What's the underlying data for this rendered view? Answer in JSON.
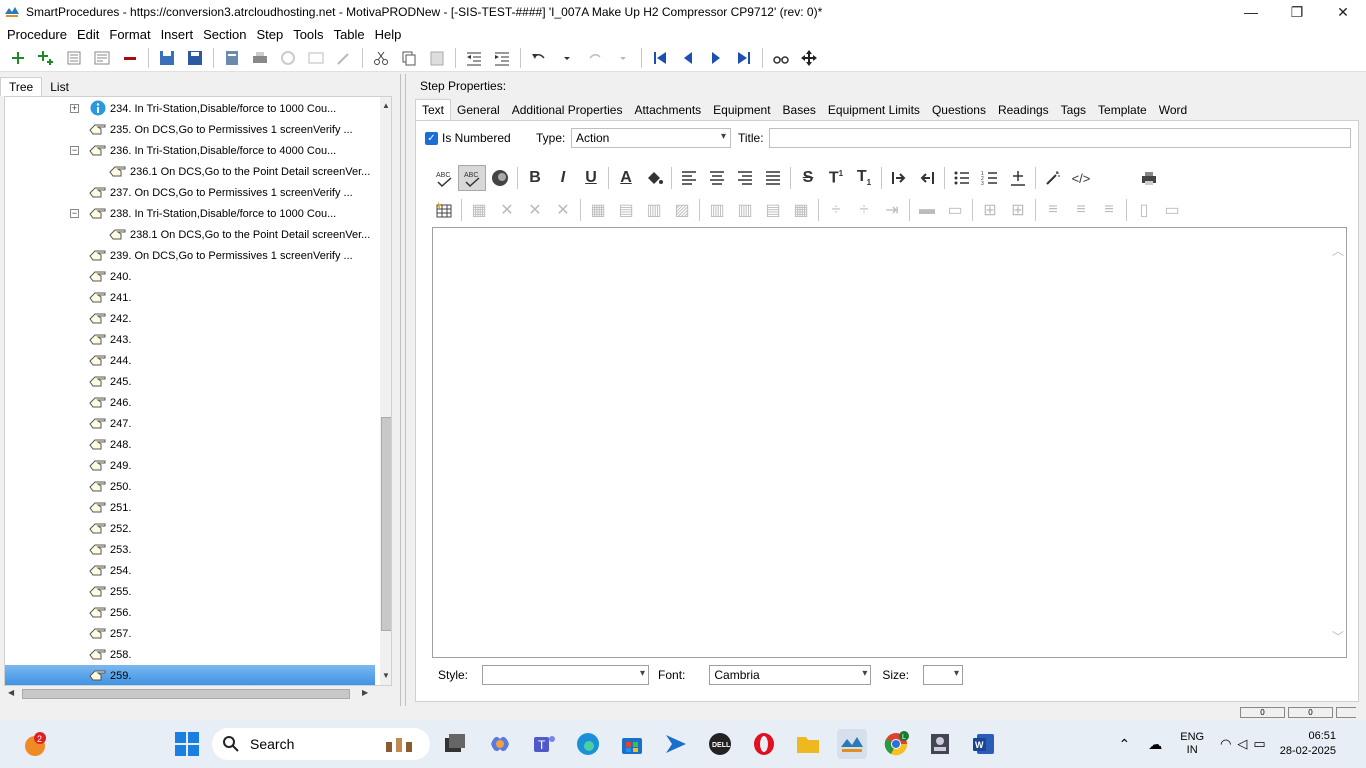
{
  "window": {
    "title": "SmartProcedures - https://conversion3.atrcloudhosting.net - MotivaPRODNew - [-SIS-TEST-####] 'I_007A Make Up H2 Compressor CP9712' (rev: 0)*",
    "minimize": "—",
    "maximize": "❐",
    "close": "✕"
  },
  "menu": [
    {
      "label": "Procedure"
    },
    {
      "label": "Edit"
    },
    {
      "label": "Format"
    },
    {
      "label": "Insert"
    },
    {
      "label": "Section"
    },
    {
      "label": "Step"
    },
    {
      "label": "Tools"
    },
    {
      "label": "Table"
    },
    {
      "label": "Help"
    }
  ],
  "left_tabs": [
    "Tree",
    "List"
  ],
  "tree": [
    {
      "label": "234. In Tri-Station,Disable/force to 1000 Cou...",
      "icon": "info-icon",
      "indent": 0,
      "expander": "+"
    },
    {
      "label": "235. On DCS,Go to Permissives 1 screenVerify ...",
      "icon": "pointing-hand-icon",
      "indent": 0
    },
    {
      "label": "236. In Tri-Station,Disable/force to 4000 Cou...",
      "icon": "pointing-hand-icon",
      "indent": 0,
      "expander": "−"
    },
    {
      "label": "236.1 On DCS,Go to the Point Detail screenVer...",
      "icon": "pointing-hand-icon",
      "indent": 1
    },
    {
      "label": "237. On DCS,Go to Permissives 1 screenVerify ...",
      "icon": "pointing-hand-icon",
      "indent": 0
    },
    {
      "label": "238. In Tri-Station,Disable/force to 1000 Cou...",
      "icon": "pointing-hand-icon",
      "indent": 0,
      "expander": "−"
    },
    {
      "label": "238.1 On DCS,Go to the Point Detail screenVer...",
      "icon": "pointing-hand-icon",
      "indent": 1
    },
    {
      "label": "239. On DCS,Go to Permissives 1 screenVerify ...",
      "icon": "pointing-hand-icon",
      "indent": 0
    },
    {
      "label": "240.",
      "icon": "pointing-hand-icon",
      "indent": 0
    },
    {
      "label": "241.",
      "icon": "pointing-hand-icon",
      "indent": 0
    },
    {
      "label": "242.",
      "icon": "pointing-hand-icon",
      "indent": 0
    },
    {
      "label": "243.",
      "icon": "pointing-hand-icon",
      "indent": 0
    },
    {
      "label": "244.",
      "icon": "pointing-hand-icon",
      "indent": 0
    },
    {
      "label": "245.",
      "icon": "pointing-hand-icon",
      "indent": 0
    },
    {
      "label": "246.",
      "icon": "pointing-hand-icon",
      "indent": 0
    },
    {
      "label": "247.",
      "icon": "pointing-hand-icon",
      "indent": 0
    },
    {
      "label": "248.",
      "icon": "pointing-hand-icon",
      "indent": 0
    },
    {
      "label": "249.",
      "icon": "pointing-hand-icon",
      "indent": 0
    },
    {
      "label": "250.",
      "icon": "pointing-hand-icon",
      "indent": 0
    },
    {
      "label": "251.",
      "icon": "pointing-hand-icon",
      "indent": 0
    },
    {
      "label": "252.",
      "icon": "pointing-hand-icon",
      "indent": 0
    },
    {
      "label": "253.",
      "icon": "pointing-hand-icon",
      "indent": 0
    },
    {
      "label": "254.",
      "icon": "pointing-hand-icon",
      "indent": 0
    },
    {
      "label": "255.",
      "icon": "pointing-hand-icon",
      "indent": 0
    },
    {
      "label": "256.",
      "icon": "pointing-hand-icon",
      "indent": 0
    },
    {
      "label": "257.",
      "icon": "pointing-hand-icon",
      "indent": 0
    },
    {
      "label": "258.",
      "icon": "pointing-hand-icon",
      "indent": 0
    },
    {
      "label": "259.",
      "icon": "pointing-hand-icon",
      "indent": 0,
      "selected": true
    }
  ],
  "step": {
    "header": "Step Properties:",
    "tabs": [
      "Text",
      "General",
      "Additional Properties",
      "Attachments",
      "Equipment",
      "Bases",
      "Equipment Limits",
      "Questions",
      "Readings",
      "Tags",
      "Template",
      "Word"
    ],
    "is_numbered_label": "Is Numbered",
    "type_label": "Type:",
    "type_value": "Action",
    "title_label": "Title:",
    "style_label": "Style:",
    "style_value": "",
    "font_label": "Font:",
    "font_value": "Cambria",
    "size_label": "Size:",
    "size_value": ""
  },
  "status": {
    "box1": "0",
    "box2": "0"
  },
  "taskbar": {
    "search_label": "Search",
    "notification_count": "2",
    "lang_line1": "ENG",
    "lang_line2": "IN",
    "time": "06:51",
    "date": "28-02-2025",
    "chrome_badge": "L"
  }
}
